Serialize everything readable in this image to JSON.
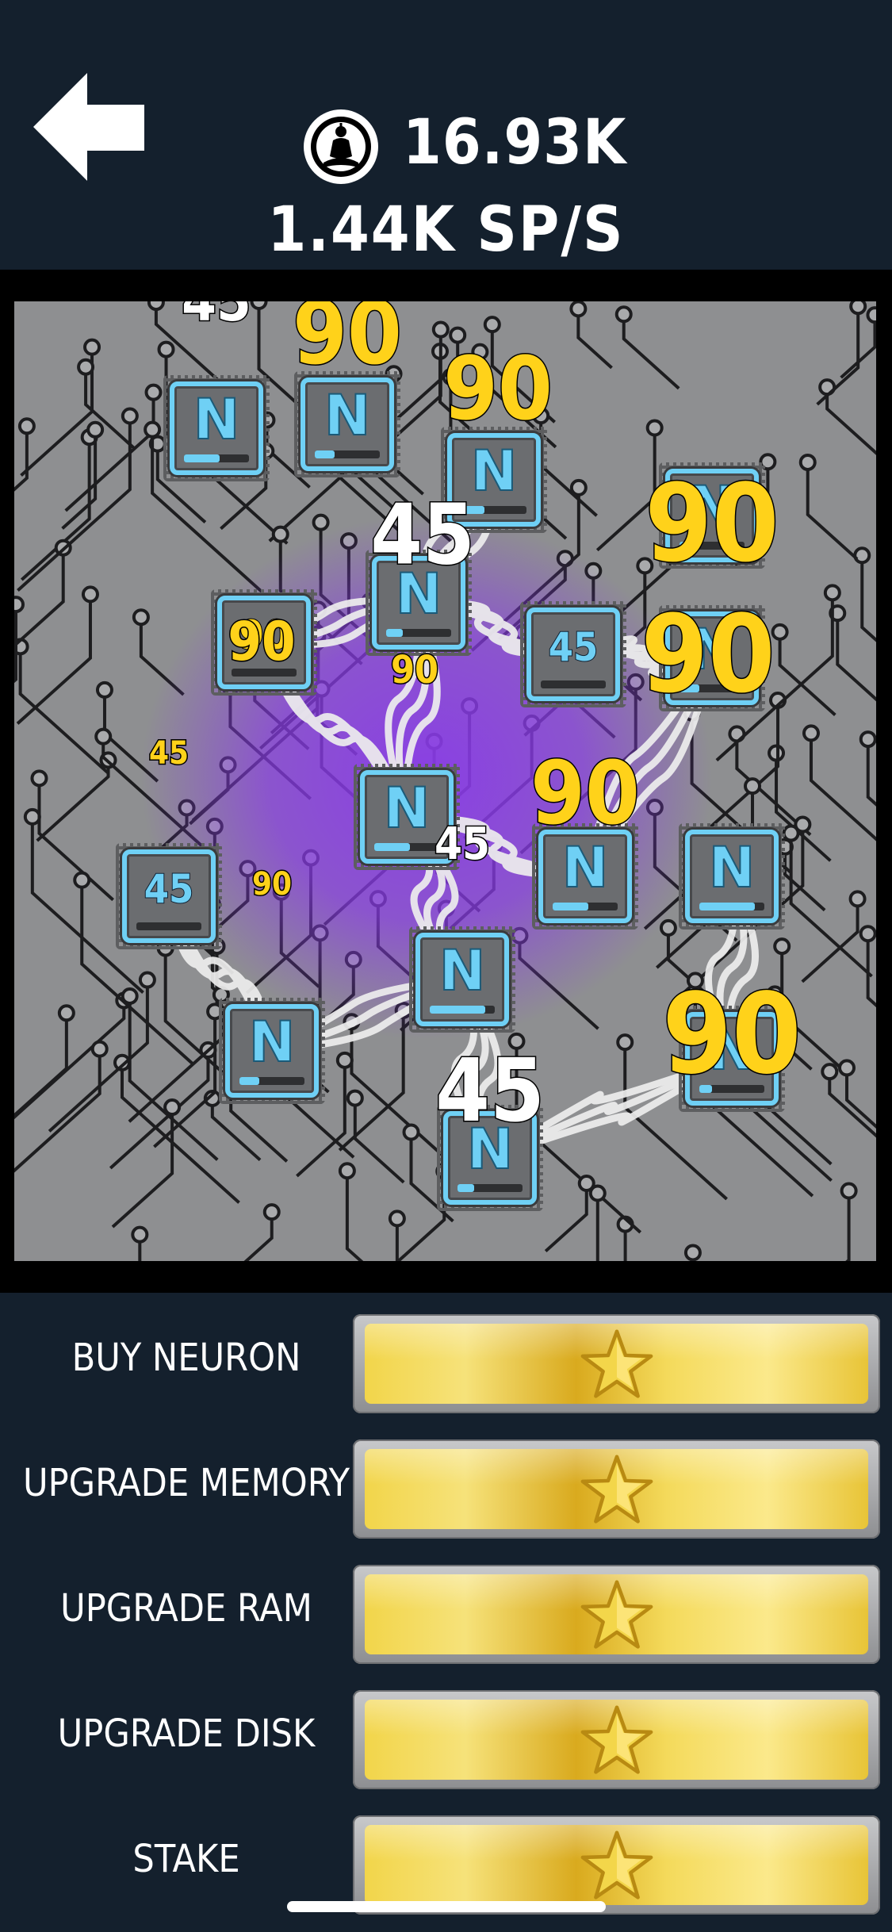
{
  "header": {
    "currency_amount": "16.93K",
    "rate": "1.44K SP/S",
    "back_icon": "arrow-left-icon",
    "currency_icon": "buddha-meditation-icon"
  },
  "board": {
    "chips": [
      {
        "id": "chip-1",
        "type": "neuron",
        "letter": "N",
        "progress": 0.55
      },
      {
        "id": "chip-2",
        "type": "neuron",
        "letter": "N",
        "progress": 0.3
      },
      {
        "id": "chip-3",
        "type": "neuron",
        "letter": "N",
        "progress": 0.35
      },
      {
        "id": "chip-4",
        "type": "neuron",
        "letter": "N",
        "progress": 0.25
      },
      {
        "id": "chip-5",
        "type": "value",
        "text": "90",
        "style": "gold",
        "progress": 0.0
      },
      {
        "id": "chip-6",
        "type": "value",
        "text": "45",
        "style": "blue",
        "progress": 0.0
      },
      {
        "id": "chip-7",
        "type": "neuron",
        "letter": "N",
        "progress": 0.3
      },
      {
        "id": "chip-8",
        "type": "neuron",
        "letter": "N",
        "progress": 0.3
      },
      {
        "id": "chip-9",
        "type": "neuron",
        "letter": "N",
        "progress": 0.55
      },
      {
        "id": "chip-10",
        "type": "value",
        "text": "45",
        "style": "blue",
        "progress": 0.0
      },
      {
        "id": "chip-11",
        "type": "neuron",
        "letter": "N",
        "progress": 0.55
      },
      {
        "id": "chip-12",
        "type": "neuron",
        "letter": "N",
        "progress": 0.85
      },
      {
        "id": "chip-13",
        "type": "neuron",
        "letter": "N",
        "progress": 0.85
      },
      {
        "id": "chip-14",
        "type": "neuron",
        "letter": "N",
        "progress": 0.3
      },
      {
        "id": "chip-15",
        "type": "neuron",
        "letter": "N",
        "progress": 0.2
      },
      {
        "id": "chip-16",
        "type": "neuron",
        "letter": "N",
        "progress": 0.25
      }
    ],
    "floating_numbers": [
      "45",
      "90",
      "90",
      "90",
      "45",
      "90",
      "90",
      "90",
      "45",
      "90",
      "90",
      "45",
      "90",
      "45"
    ],
    "colors": {
      "gold": "#ffd21a",
      "chip_border": "#6fd0f5",
      "glow": "#8a3be8",
      "board": "#8e8f91"
    }
  },
  "actions": [
    {
      "label": "BUY NEURON",
      "icon": "star-icon"
    },
    {
      "label": "UPGRADE MEMORY",
      "icon": "star-icon"
    },
    {
      "label": "UPGRADE RAM",
      "icon": "star-icon"
    },
    {
      "label": "UPGRADE DISK",
      "icon": "star-icon"
    },
    {
      "label": "STAKE",
      "icon": "star-icon"
    }
  ]
}
